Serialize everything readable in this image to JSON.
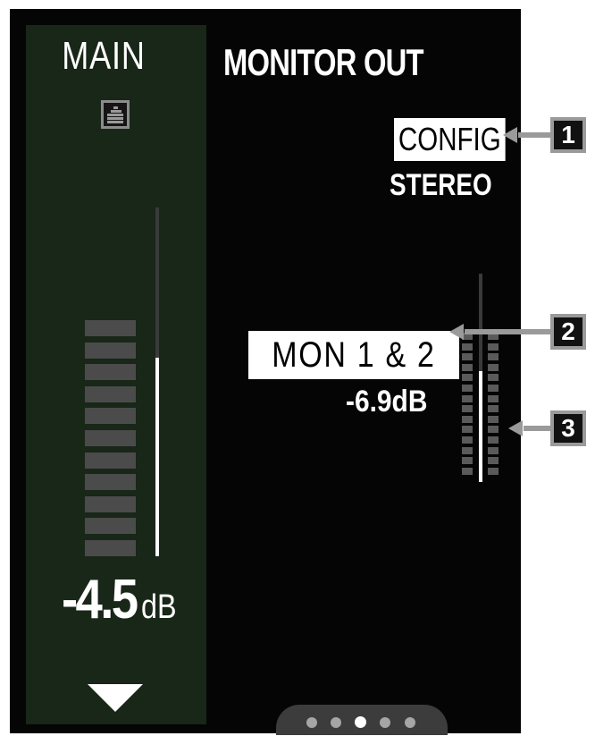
{
  "main": {
    "label": "MAIN",
    "icon": "grid-meter-icon",
    "level_db_value": "-4.5",
    "level_db_unit": "dB",
    "fader_level": 0.57,
    "meter_segments_lit": 11
  },
  "monitor": {
    "title": "MONITOR OUT",
    "config_label": "CONFIG",
    "config_value": "STEREO",
    "output_name": "MON 1 & 2",
    "output_level": "-6.9dB",
    "fader_level": 0.53
  },
  "pager": {
    "page_count": 5,
    "active_page": 3
  },
  "callouts": [
    "1",
    "2",
    "3"
  ],
  "colors": {
    "screen_bg": "#050505",
    "main_panel_bg": "#182718",
    "callout_gray": "#9a9a9a",
    "meter_segment": "#4b4b4b"
  }
}
